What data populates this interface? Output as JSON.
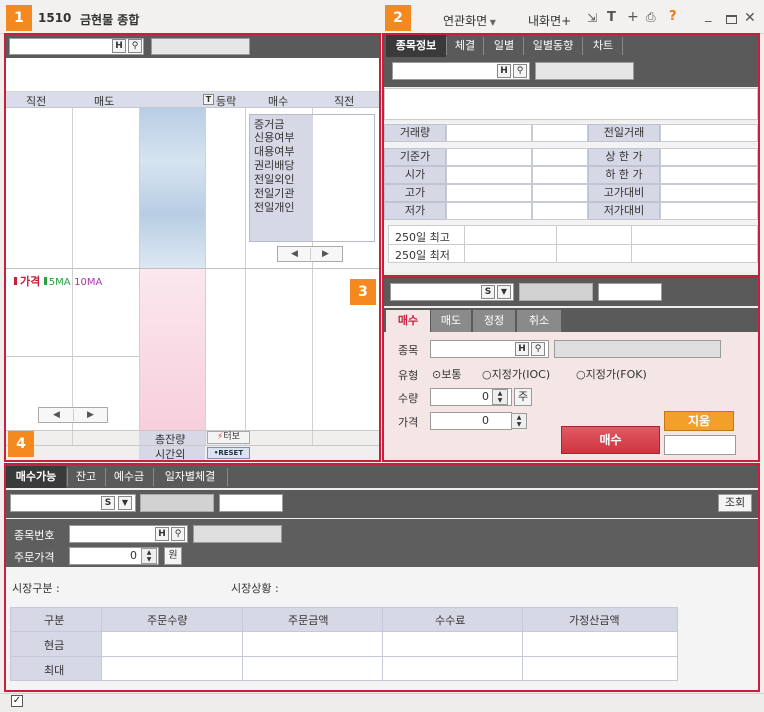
{
  "title": {
    "screen_no": "1510",
    "name": "금현물 종합",
    "related": "연관화면",
    "my_screen": "내화면+"
  },
  "badges": [
    "1",
    "2",
    "3",
    "4"
  ],
  "panel1": {
    "h_button": "H",
    "headers": [
      "직전",
      "매도",
      "등락",
      "매수",
      "직전"
    ],
    "t_button": "T",
    "investor_list": [
      "증거금",
      "신용여부",
      "대용여부",
      "권리배당",
      "전일외인",
      "전일기관",
      "전일개인"
    ],
    "ma_labels": {
      "price": "가격",
      "ma5": "5MA",
      "ma10": "10MA"
    },
    "bottom": {
      "total_qty": "총잔량",
      "after_hours": "시간외",
      "bull": "터보",
      "reset": "RESET"
    }
  },
  "panel2": {
    "tabs": [
      "종목정보",
      "체결",
      "일별",
      "일별동향",
      "차트"
    ],
    "h_button": "H",
    "rows": [
      {
        "l": "거래량",
        "r": "전일거래"
      },
      {
        "l": "기준가",
        "r": "상 한 가"
      },
      {
        "l": "시가",
        "r": "하 한 가"
      },
      {
        "l": "고가",
        "r": "고가대비"
      },
      {
        "l": "저가",
        "r": "저가대비"
      }
    ],
    "high250": "250일 최고",
    "low250": "250일 최저"
  },
  "panel3": {
    "s_button": "S",
    "tabs": [
      "매수",
      "매도",
      "정정",
      "취소"
    ],
    "fields": {
      "item": "종목",
      "type": "유형",
      "qty": "수량",
      "price": "가격"
    },
    "h_button": "H",
    "radios": [
      "보통",
      "지정가(IOC)",
      "지정가(FOK)"
    ],
    "qty_value": "0",
    "qty_unit": "주",
    "price_value": "0",
    "clear_btn": "지움",
    "buy_btn": "매수"
  },
  "panel4": {
    "tabs": [
      "매수가능",
      "잔고",
      "예수금",
      "일자별체결"
    ],
    "s_button": "S",
    "lookup": "조회",
    "item_no": "종목번호",
    "order_price": "주문가격",
    "h_button": "H",
    "price_value": "0",
    "won": "원",
    "market_type": "시장구분 :",
    "market_status": "시장상황 :",
    "table_headers": [
      "구분",
      "주문수량",
      "주문금액",
      "수수료",
      "가정산금액"
    ],
    "table_rows": [
      "현금",
      "최대"
    ]
  },
  "colors": {
    "accent": "#c8203c",
    "badge": "#f48a1f",
    "tab_dark": "#5a5a5a",
    "buy": "#d8404f"
  }
}
